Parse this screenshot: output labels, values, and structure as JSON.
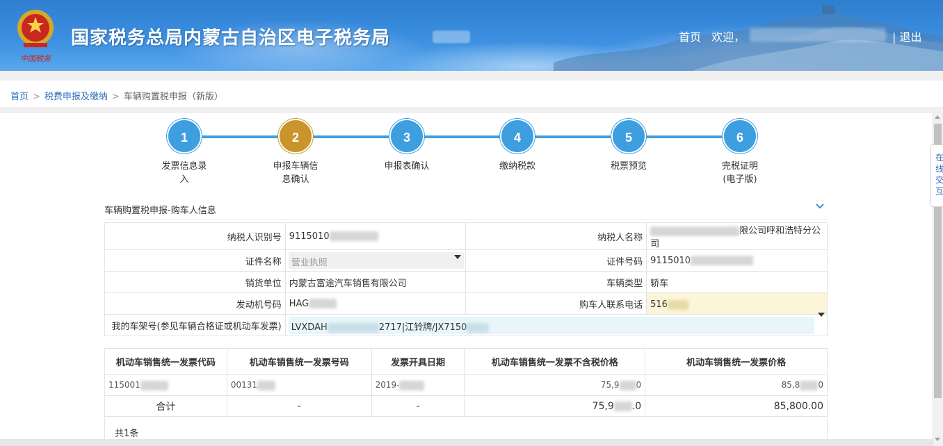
{
  "header": {
    "site_title": "国家税务总局内蒙古自治区电子税务局",
    "home_link": "首页",
    "welcome": "欢迎，",
    "logout": "| 退出",
    "colors": {
      "header_blue": "#3b8ee0",
      "step_blue": "#3d9ee0",
      "step_active": "#c9952a"
    }
  },
  "breadcrumb": {
    "home": "首页",
    "level2": "税费申报及缴纳",
    "current": "车辆购置税申报（新版）"
  },
  "side_tab": {
    "label": "在线交互"
  },
  "steps": [
    {
      "number": "1",
      "label": "发票信息录入",
      "active": false
    },
    {
      "number": "2",
      "label": "申报车辆信息确认",
      "active": true
    },
    {
      "number": "3",
      "label": "申报表确认",
      "active": false
    },
    {
      "number": "4",
      "label": "缴纳税款",
      "active": false
    },
    {
      "number": "5",
      "label": "税票预览",
      "active": false
    },
    {
      "number": "6",
      "label": "完税证明(电子版)",
      "active": false
    }
  ],
  "section": {
    "title": "车辆购置税申报-购车人信息"
  },
  "form": {
    "taxpayer_id_label": "纳税人识别号",
    "taxpayer_id_value": "9115010",
    "taxpayer_name_label": "纳税人名称",
    "taxpayer_name_value": "限公司呼和浩特分公司",
    "cert_name_label": "证件名称",
    "cert_name_value": "营业执照",
    "cert_no_label": "证件号码",
    "cert_no_value": "9115010",
    "seller_label": "销货单位",
    "seller_value": "内蒙古富途汽车销售有限公司",
    "vehicle_type_label": "车辆类型",
    "vehicle_type_value": "轿车",
    "engine_no_label": "发动机号码",
    "engine_no_value": "HAG",
    "buyer_phone_label": "购车人联系电话",
    "buyer_phone_value": "516",
    "vin_label": "我的车架号(参见车辆合格证或机动车发票)",
    "vin_value_prefix": "LVXDAH",
    "vin_value_suffix": "2717|江铃牌/JX7150"
  },
  "invoice_table": {
    "headers": [
      "机动车销售统一发票代码",
      "机动车销售统一发票号码",
      "发票开具日期",
      "机动车销售统一发票不含税价格",
      "机动车销售统一发票价格"
    ],
    "rows": [
      {
        "code": "115001",
        "number": "00131",
        "date": "2019-",
        "price_ex_tax": "75,9",
        "price_ex_tax_tail": "0",
        "price": "85,8",
        "price_tail": "0"
      }
    ],
    "total": {
      "label": "合计",
      "number": "-",
      "date": "-",
      "price_ex_tax": "75,9",
      "price_ex_tax_tail": ".0",
      "price": "85,800.00"
    },
    "count": "共1条"
  }
}
